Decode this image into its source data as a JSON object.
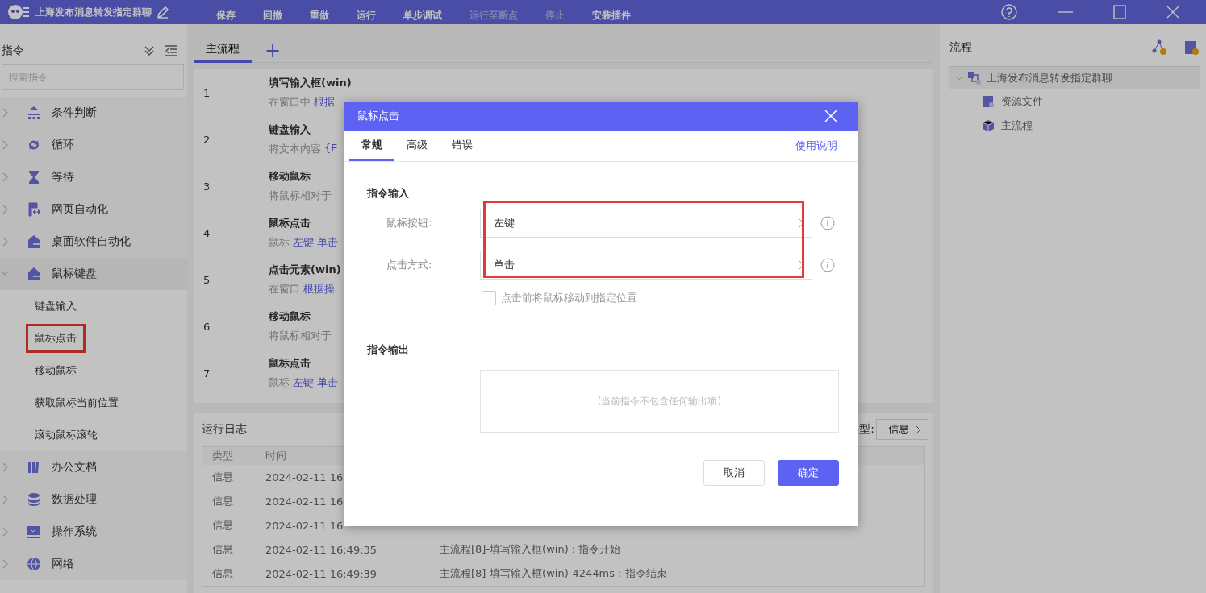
{
  "app": {
    "title": "上海发布消息转发指定群聊"
  },
  "toolbar": [
    {
      "label": "保存",
      "disabled": false
    },
    {
      "label": "回撤",
      "disabled": false
    },
    {
      "label": "重做",
      "disabled": false
    },
    {
      "label": "运行",
      "disabled": false
    },
    {
      "label": "单步调试",
      "disabled": false
    },
    {
      "label": "运行至断点",
      "disabled": true
    },
    {
      "label": "停止",
      "disabled": true
    },
    {
      "label": "安装插件",
      "disabled": false
    }
  ],
  "sidebar": {
    "title": "指令",
    "search_placeholder": "搜索指令",
    "items": [
      {
        "label": "条件判断",
        "expanded": false
      },
      {
        "label": "循环",
        "expanded": false
      },
      {
        "label": "等待",
        "expanded": false
      },
      {
        "label": "网页自动化",
        "expanded": false
      },
      {
        "label": "桌面软件自动化",
        "expanded": false
      },
      {
        "label": "鼠标键盘",
        "expanded": true,
        "children": [
          {
            "label": "键盘输入",
            "annotated": false
          },
          {
            "label": "鼠标点击",
            "annotated": true
          },
          {
            "label": "移动鼠标",
            "annotated": false
          },
          {
            "label": "获取鼠标当前位置",
            "annotated": false
          },
          {
            "label": "滚动鼠标滚轮",
            "annotated": false
          }
        ]
      },
      {
        "label": "办公文档",
        "expanded": false
      },
      {
        "label": "数据处理",
        "expanded": false
      },
      {
        "label": "操作系统",
        "expanded": false
      },
      {
        "label": "网络",
        "expanded": false
      }
    ]
  },
  "tabs": [
    {
      "label": "主流程",
      "selected": true
    }
  ],
  "add_tab": "+",
  "steps": [
    {
      "number": "1",
      "title": "填写输入框(win)",
      "text": "在窗口中",
      "link": "根据"
    },
    {
      "number": "2",
      "title": "键盘输入",
      "text": "将文本内容",
      "link": "{E"
    },
    {
      "number": "3",
      "title": "移动鼠标",
      "text": "将鼠标相对于"
    },
    {
      "number": "4",
      "title": "鼠标点击",
      "text": "鼠标",
      "link": "左键 单击"
    },
    {
      "number": "5",
      "title": "点击元素(win)",
      "text": "在窗口",
      "link": "根据操"
    },
    {
      "number": "6",
      "title": "移动鼠标",
      "text": "将鼠标相对于"
    },
    {
      "number": "7",
      "title": "鼠标点击",
      "text": "鼠标",
      "link": "左键 单击"
    }
  ],
  "log": {
    "title": "运行日志",
    "filter_label": "型:",
    "filter_value": "信息",
    "columns": [
      "类型",
      "时间"
    ],
    "rows": [
      {
        "type": "信息",
        "time": "2024-02-11 16"
      },
      {
        "type": "信息",
        "time": "2024-02-11 16"
      },
      {
        "type": "信息",
        "time": "2024-02-11 16"
      },
      {
        "type": "信息",
        "time": "2024-02-11 16:49:35",
        "message": "主流程[8]-填写输入框(win) : 指令开始"
      },
      {
        "type": "信息",
        "time": "2024-02-11 16:49:39",
        "message": "主流程[8]-填写输入框(win)-4244ms : 指令结束"
      }
    ]
  },
  "flow_panel": {
    "title": "流程",
    "tree": {
      "label": "上海发布消息转发指定群聊",
      "expanded": true,
      "children": [
        {
          "label": "资源文件"
        },
        {
          "label": "主流程"
        }
      ]
    }
  },
  "dialog": {
    "title": "鼠标点击",
    "tabs": [
      {
        "label": "常规",
        "selected": true
      },
      {
        "label": "高级",
        "selected": false
      },
      {
        "label": "错误",
        "selected": false
      }
    ],
    "help_link": "使用说明",
    "input_section": "指令输入",
    "fields": [
      {
        "label": "鼠标按钮:",
        "value": "左键"
      },
      {
        "label": "点击方式:",
        "value": "单击"
      }
    ],
    "fields_annotated": true,
    "checkbox": {
      "label": "点击前将鼠标移动到指定位置",
      "checked": false
    },
    "output_section": "指令输出",
    "output_placeholder": "(当前指令不包含任何输出项)",
    "buttons": [
      {
        "label": "取消",
        "kind": "secondary"
      },
      {
        "label": "确定",
        "kind": "primary"
      }
    ]
  }
}
